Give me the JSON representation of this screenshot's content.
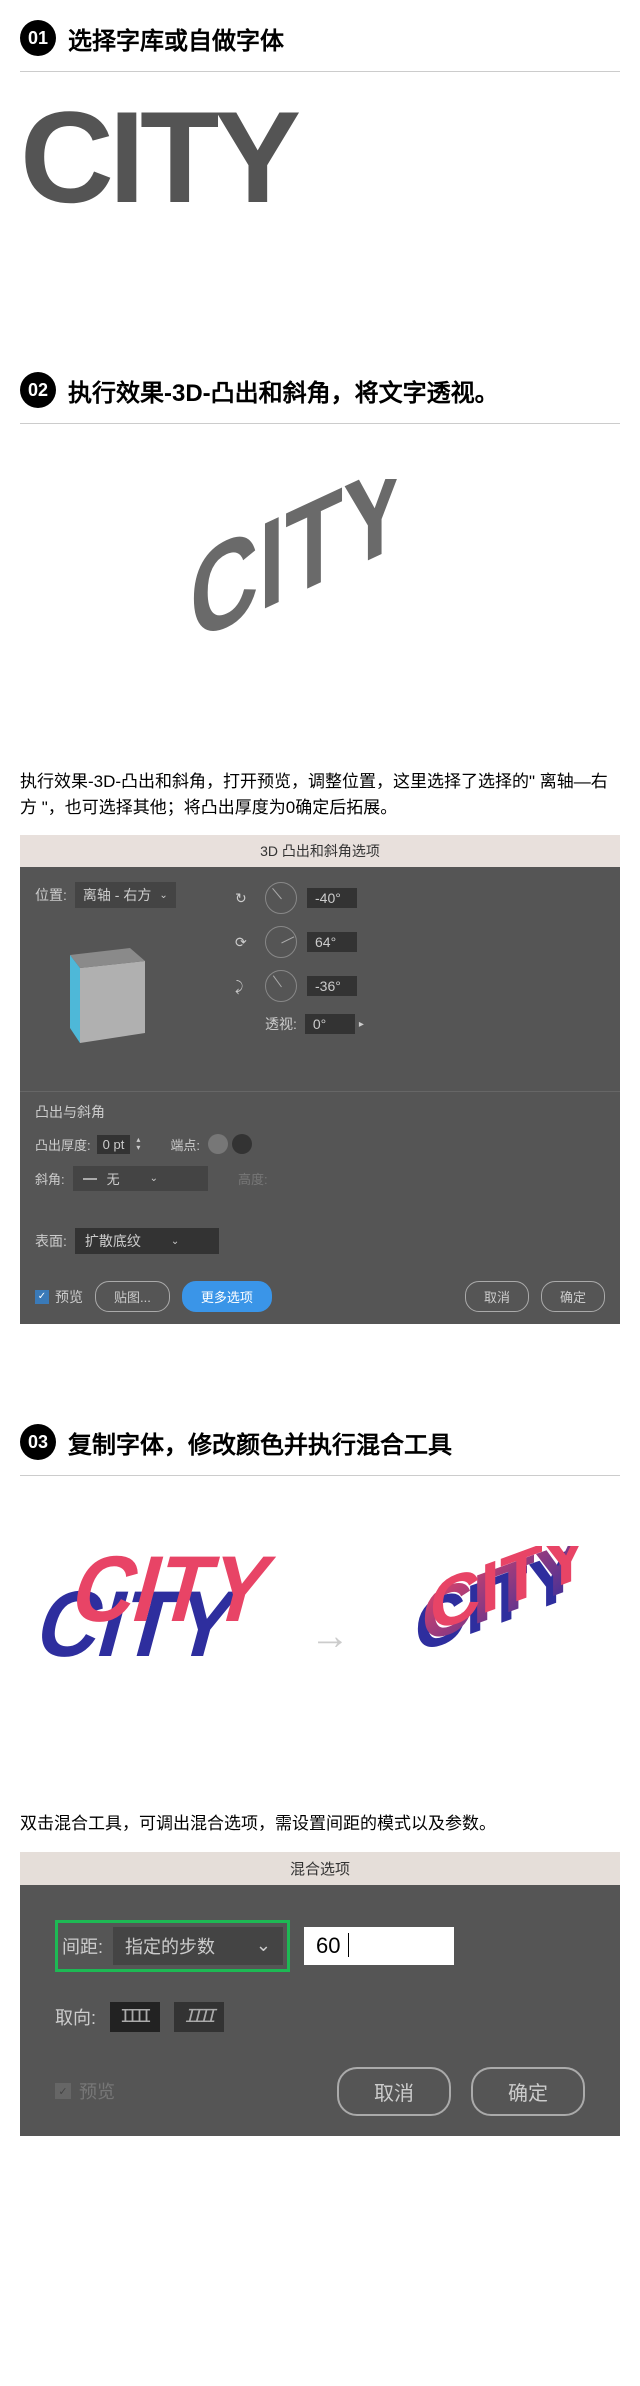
{
  "step1": {
    "num": "01",
    "title": "选择字库或自做字体",
    "displayText": "CITY"
  },
  "step2": {
    "num": "02",
    "title": "执行效果-3D-凸出和斜角，将文字透视。",
    "desc": "执行效果-3D-凸出和斜角，打开预览，调整位置，这里选择了选择的\" 离轴—右方 \"，也可选择其他；将凸出厚度为0确定后拓展。"
  },
  "dialog3d": {
    "title": "3D 凸出和斜角选项",
    "position_label": "位置:",
    "position_value": "离轴 - 右方",
    "angle1": "-40°",
    "angle2": "64°",
    "angle3": "-36°",
    "perspective_label": "透视:",
    "perspective_value": "0°",
    "extrude_title": "凸出与斜角",
    "depth_label": "凸出厚度:",
    "depth_value": "0 pt",
    "cap_label": "端点:",
    "bevel_label": "斜角:",
    "bevel_value": "无",
    "height_label": "高度:",
    "surface_label": "表面:",
    "surface_value": "扩散底纹",
    "preview_label": "预览",
    "btn_map": "贴图...",
    "btn_more": "更多选项",
    "btn_cancel": "取消",
    "btn_ok": "确定"
  },
  "step3": {
    "num": "03",
    "title": "复制字体，修改颜色并执行混合工具",
    "desc": "双击混合工具，可调出混合选项，需设置间距的模式以及参数。",
    "overlay_text": "CITY"
  },
  "dialogBlend": {
    "title": "混合选项",
    "spacing_label": "间距:",
    "spacing_value": "指定的步数",
    "steps_value": "60",
    "orient_label": "取向:",
    "preview_label": "预览",
    "btn_cancel": "取消",
    "btn_ok": "确定"
  }
}
